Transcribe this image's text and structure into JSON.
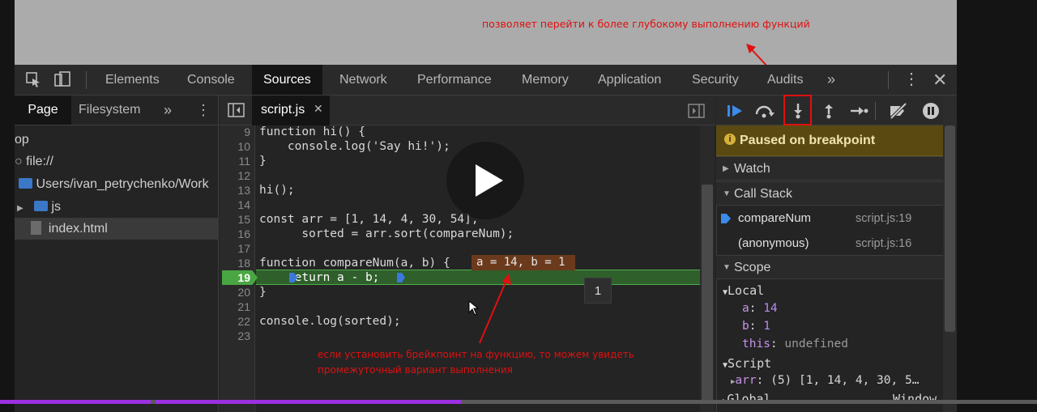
{
  "annotations": {
    "top": "позволяет перейти к более глубокому выполнению функций",
    "bottom_line1": "если установить брейкпоинт на функцию, то можем увидеть",
    "bottom_line2": "промежуточный вариант выполнения"
  },
  "devtools_tabs": [
    "Elements",
    "Console",
    "Sources",
    "Network",
    "Performance",
    "Memory",
    "Application",
    "Security",
    "Audits"
  ],
  "active_tab": "Sources",
  "navigator": {
    "tabs": [
      "Page",
      "Filesystem"
    ],
    "tree": [
      "op",
      "file://",
      "Users/ivan_petrychenko/Work",
      "js",
      "index.html"
    ]
  },
  "editor": {
    "file_tab": "script.js",
    "lines": [
      {
        "n": "9",
        "text": "function hi() {"
      },
      {
        "n": "10",
        "text": "    console.log('Say hi!');"
      },
      {
        "n": "11",
        "text": "}"
      },
      {
        "n": "12",
        "text": ""
      },
      {
        "n": "13",
        "text": "hi();"
      },
      {
        "n": "14",
        "text": ""
      },
      {
        "n": "15",
        "text": "const arr = [1, 14, 4, 30, 54],"
      },
      {
        "n": "16",
        "text": "      sorted = arr.sort(compareNum);"
      },
      {
        "n": "17",
        "text": ""
      },
      {
        "n": "18",
        "text": "function compareNum(a, b) {"
      },
      {
        "n": "19",
        "text": "    return a - b;"
      },
      {
        "n": "20",
        "text": "}"
      },
      {
        "n": "21",
        "text": ""
      },
      {
        "n": "22",
        "text": "console.log(sorted);"
      },
      {
        "n": "23",
        "text": ""
      }
    ],
    "inline_values": "a = 14, b = 1",
    "tooltip_value": "1",
    "breakpoint_line": "19"
  },
  "debugger": {
    "paused_message": "Paused on breakpoint",
    "sections": {
      "watch": "Watch",
      "call_stack": "Call Stack",
      "scope": "Scope"
    },
    "call_stack": [
      {
        "name": "compareNum",
        "location": "script.js:19"
      },
      {
        "name": "(anonymous)",
        "location": "script.js:16"
      }
    ],
    "scope": {
      "local_label": "Local",
      "local_vars": [
        {
          "name": "a",
          "value": "14"
        },
        {
          "name": "b",
          "value": "1"
        },
        {
          "name": "this",
          "value": "undefined"
        }
      ],
      "script_label": "Script",
      "script_vars": [
        {
          "name": "arr",
          "value": "(5) [1, 14, 4, 30, 5…"
        }
      ],
      "global_label": "Global",
      "global_value": "Window"
    }
  },
  "colors": {
    "annotation": "#e01010",
    "breakpoint_line_bg": "#2f5f2b",
    "paused_banner_bg": "#5a4a12",
    "inline_value_bg": "#6b3a1c",
    "progress_played": "#9b30e0"
  }
}
